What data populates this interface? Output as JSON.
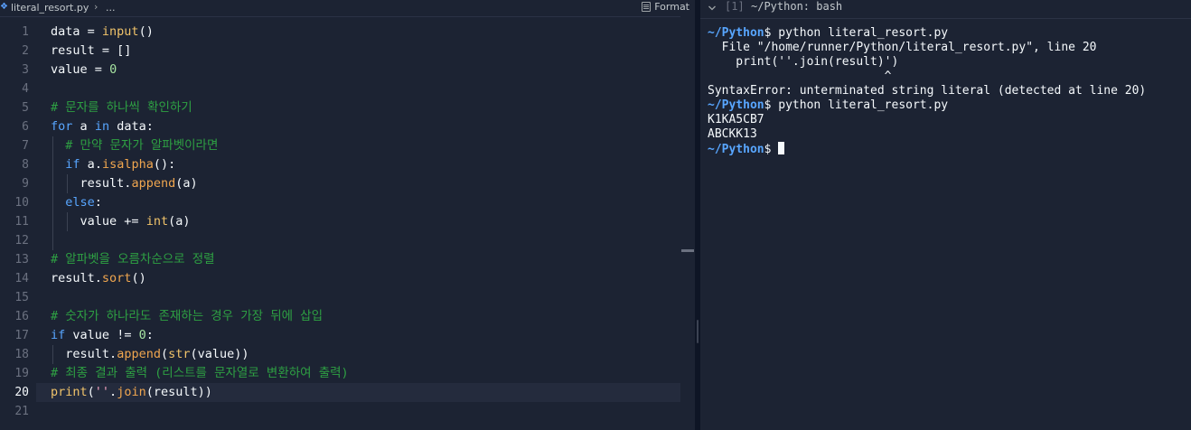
{
  "editor": {
    "breadcrumb_file": "literal_resort.py",
    "breadcrumb_sep": "›",
    "breadcrumb_more": "...",
    "format_label": "Format",
    "active_line": "20",
    "line_numbers": [
      "1",
      "2",
      "3",
      "4",
      "5",
      "6",
      "7",
      "8",
      "9",
      "10",
      "11",
      "12",
      "13",
      "14",
      "15",
      "16",
      "17",
      "18",
      "19",
      "20",
      "21"
    ],
    "comments": {
      "c5": "# 문자를 하나씩 확인하기",
      "c7": "# 만약 문자가 알파벳이라면",
      "c13": "# 알파벳을 오름차순으로 정렬",
      "c16": "# 숫자가 하나라도 존재하는 경우 가장 뒤에 삽입",
      "c19": "# 최종 결과 출력 (리스트를 문자열로 변환하여 출력)"
    }
  },
  "terminal": {
    "tab_index": "[1]",
    "tab_title": "~/Python: bash",
    "prompt": "~/Python",
    "lines": {
      "l1_cmd": "$ python literal_resort.py",
      "l2": "  File \"/home/runner/Python/literal_resort.py\", line 20",
      "l3": "    print(''.join(result)')",
      "l4": "                         ^",
      "l5": "SyntaxError: unterminated string literal (detected at line 20)",
      "l6_cmd": "$ python literal_resort.py",
      "l7": "K1KA5CB7",
      "l8": "ABCKK13",
      "l9_cmd": "$ "
    }
  },
  "colors": {
    "background": "#1c2333",
    "keyword": "#58a6ff",
    "function": "#f0c36a",
    "number": "#a6e3a1",
    "string": "#f5a3c0",
    "comment": "#2ea043",
    "prompt": "#58a6ff"
  },
  "icons": {
    "file": "python-file-icon",
    "format": "format-icon",
    "chevron": "chevron-down-icon"
  }
}
